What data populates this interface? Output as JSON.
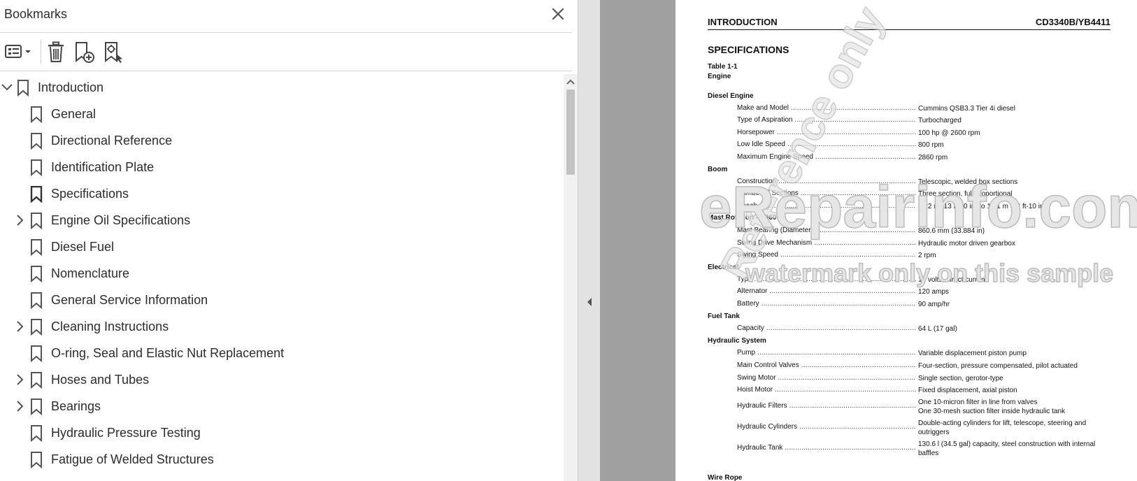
{
  "bookmarks_panel": {
    "title": "Bookmarks",
    "close_icon": "close-icon",
    "toolbar": {
      "options_icon": "bookmark-options-icon",
      "delete_icon": "trash-icon",
      "new_bookmark_icon": "new-bookmark-icon",
      "find_bookmark_icon": "find-current-bookmark-icon"
    },
    "items": [
      {
        "label": "Introduction",
        "level": 0,
        "expanded": true,
        "has_children": true
      },
      {
        "label": "General",
        "level": 1,
        "has_children": false
      },
      {
        "label": "Directional Reference",
        "level": 1,
        "has_children": false
      },
      {
        "label": "Identification Plate",
        "level": 1,
        "has_children": false
      },
      {
        "label": "Specifications",
        "level": 1,
        "has_children": false,
        "selected": true
      },
      {
        "label": "Engine Oil Specifications",
        "level": 1,
        "has_children": true
      },
      {
        "label": "Diesel Fuel",
        "level": 1,
        "has_children": false
      },
      {
        "label": "Nomenclature",
        "level": 1,
        "has_children": false
      },
      {
        "label": "General Service Information",
        "level": 1,
        "has_children": false
      },
      {
        "label": "Cleaning Instructions",
        "level": 1,
        "has_children": true
      },
      {
        "label": "O-ring, Seal and Elastic Nut Replacement",
        "level": 1,
        "has_children": false
      },
      {
        "label": "Hoses and Tubes",
        "level": 1,
        "has_children": true
      },
      {
        "label": "Bearings",
        "level": 1,
        "has_children": true
      },
      {
        "label": "Hydraulic Pressure Testing",
        "level": 1,
        "has_children": false
      },
      {
        "label": "Fatigue of Welded Structures",
        "level": 1,
        "has_children": false
      }
    ]
  },
  "document": {
    "header_left": "INTRODUCTION",
    "header_right": "CD3340B/YB4411",
    "section_title": "SPECIFICATIONS",
    "table_number": "Table 1-1",
    "table_name": "Engine",
    "groups": [
      {
        "name": "Diesel Engine",
        "rows": [
          {
            "label": "Make and Model",
            "value": "Cummins QSB3.3 Tier 4i diesel"
          },
          {
            "label": "Type of Aspiration",
            "value": "Turbocharged"
          },
          {
            "label": "Horsepower",
            "value": "100 hp @ 2600 rpm"
          },
          {
            "label": "Low Idle Speed",
            "value": "800 rpm"
          },
          {
            "label": "Maximum Engine Speed",
            "value": "2860 rpm"
          }
        ]
      },
      {
        "name": "Boom",
        "rows": [
          {
            "label": "Construction",
            "value": "Telescopic, welded box sections"
          },
          {
            "label": "Number of Sections",
            "value": "Three section, full proportional"
          },
          {
            "label": "Reach",
            "value": "4.22 m (13 ft-10 in) to 10.1 m (32 ft-10 in)"
          }
        ]
      },
      {
        "name": "Mast Rotation — 360°",
        "rows": [
          {
            "label": "Mast Bearing (Diameter)",
            "value": "860.6 mm (33.884 in)"
          },
          {
            "label": "Swing Drive Mechanism",
            "value": "Hydraulic motor driven gearbox"
          },
          {
            "label": "Swing Speed",
            "value": "2 rpm"
          }
        ]
      },
      {
        "name": "Electrical",
        "rows": [
          {
            "label": "Type",
            "value": "12 volts, direct current"
          },
          {
            "label": "Alternator",
            "value": "120 amps"
          },
          {
            "label": "Battery",
            "value": "90 amp/hr"
          }
        ]
      },
      {
        "name": "Fuel Tank",
        "rows": [
          {
            "label": "Capacity",
            "value": "64 L (17 gal)"
          }
        ]
      },
      {
        "name": "Hydraulic System",
        "rows": [
          {
            "label": "Pump",
            "value": "Variable displacement piston pump"
          },
          {
            "label": "Main Control Valves",
            "value": "Four-section, pressure compensated, pilot actuated"
          },
          {
            "label": "Swing Motor",
            "value": "Single section, gerotor-type"
          },
          {
            "label": "Hoist Motor",
            "value": "Fixed displacement, axial piston"
          },
          {
            "label": "Hydraulic Filters",
            "value": "One 10-micron filter in line from valves\nOne 30-mesh suction filter inside hydraulic tank"
          },
          {
            "label": "Hydraulic Cylinders",
            "value": "Double-acting cylinders for lift, telescope, steering and outriggers"
          },
          {
            "label": "Hydraulic Tank",
            "value": "130.6 l (34.5 gal) capacity, steel construction with internal baffles"
          }
        ]
      },
      {
        "name": "Wire Rope",
        "rows": []
      }
    ],
    "watermark": {
      "main": "eRepairinfo.com",
      "sub": "watermark only on this sample",
      "diagonal": "Reference only"
    }
  },
  "colors": {
    "panel_bg": "#ffffff",
    "text": "#2c2c2c",
    "divider_bg": "#e2e2e2",
    "doc_bg": "#a0a0a0",
    "scroll_thumb": "#c2c2c2"
  }
}
